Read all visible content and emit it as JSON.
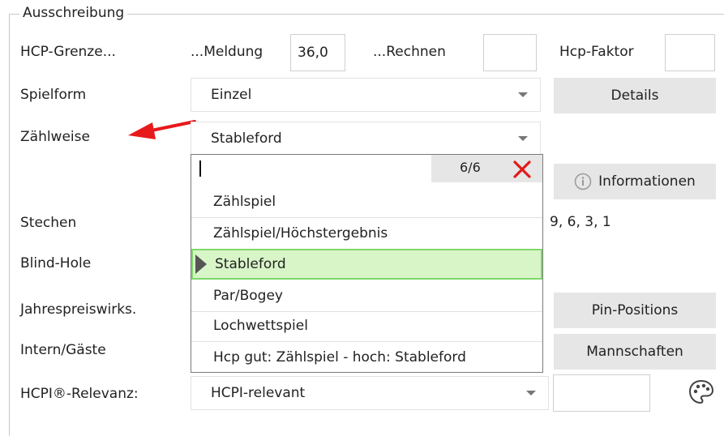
{
  "section": {
    "legend": "Ausschreibung"
  },
  "labels": {
    "hcp_grenze": "HCP-Grenze...",
    "meldung": "...Meldung",
    "rechnen": "...Rechnen",
    "hcp_faktor": "Hcp-Faktor",
    "spielform": "Spielform",
    "zaehlweise": "Zählweise",
    "stechen": "Stechen",
    "blind_hole": "Blind-Hole",
    "jahrespreis": "Jahrespreiswirks.",
    "intern_gaeste": "Intern/Gäste",
    "hcpi_relevanz": "HCPI®-Relevanz:"
  },
  "fields": {
    "meldung_value": "36,0",
    "rechnen_value": "",
    "hcp_faktor_value": "",
    "spielform_value": "Einzel",
    "zaehlweise_value": "Stableford",
    "stechen_value": "9, 6, 3, 1",
    "hcpi_value": "HCPI-relevant",
    "hcpi_extra_value": ""
  },
  "buttons": {
    "details": "Details",
    "informationen": "Informationen",
    "pin_positions": "Pin-Positions",
    "mannschaften": "Mannschaften"
  },
  "dropdown": {
    "search_value": "",
    "count": "6/6",
    "items": [
      {
        "label": "Zählspiel"
      },
      {
        "label": "Zählspiel/Höchstergebnis"
      },
      {
        "label": "Stableford"
      },
      {
        "label": "Par/Bogey"
      },
      {
        "label": "Lochwettspiel"
      },
      {
        "label": "Hcp gut: Zählspiel - hoch: Stableford"
      }
    ],
    "selected_index": 2
  },
  "icons": {
    "close": "close-icon",
    "info": "info-icon",
    "palette": "palette-icon",
    "arrow": "red-arrow-annotation"
  },
  "colors": {
    "selection_bg": "#d8f5c8",
    "selection_border": "#7ed86a",
    "close_red": "#e01b1b",
    "arrow_red": "#e8191b"
  }
}
